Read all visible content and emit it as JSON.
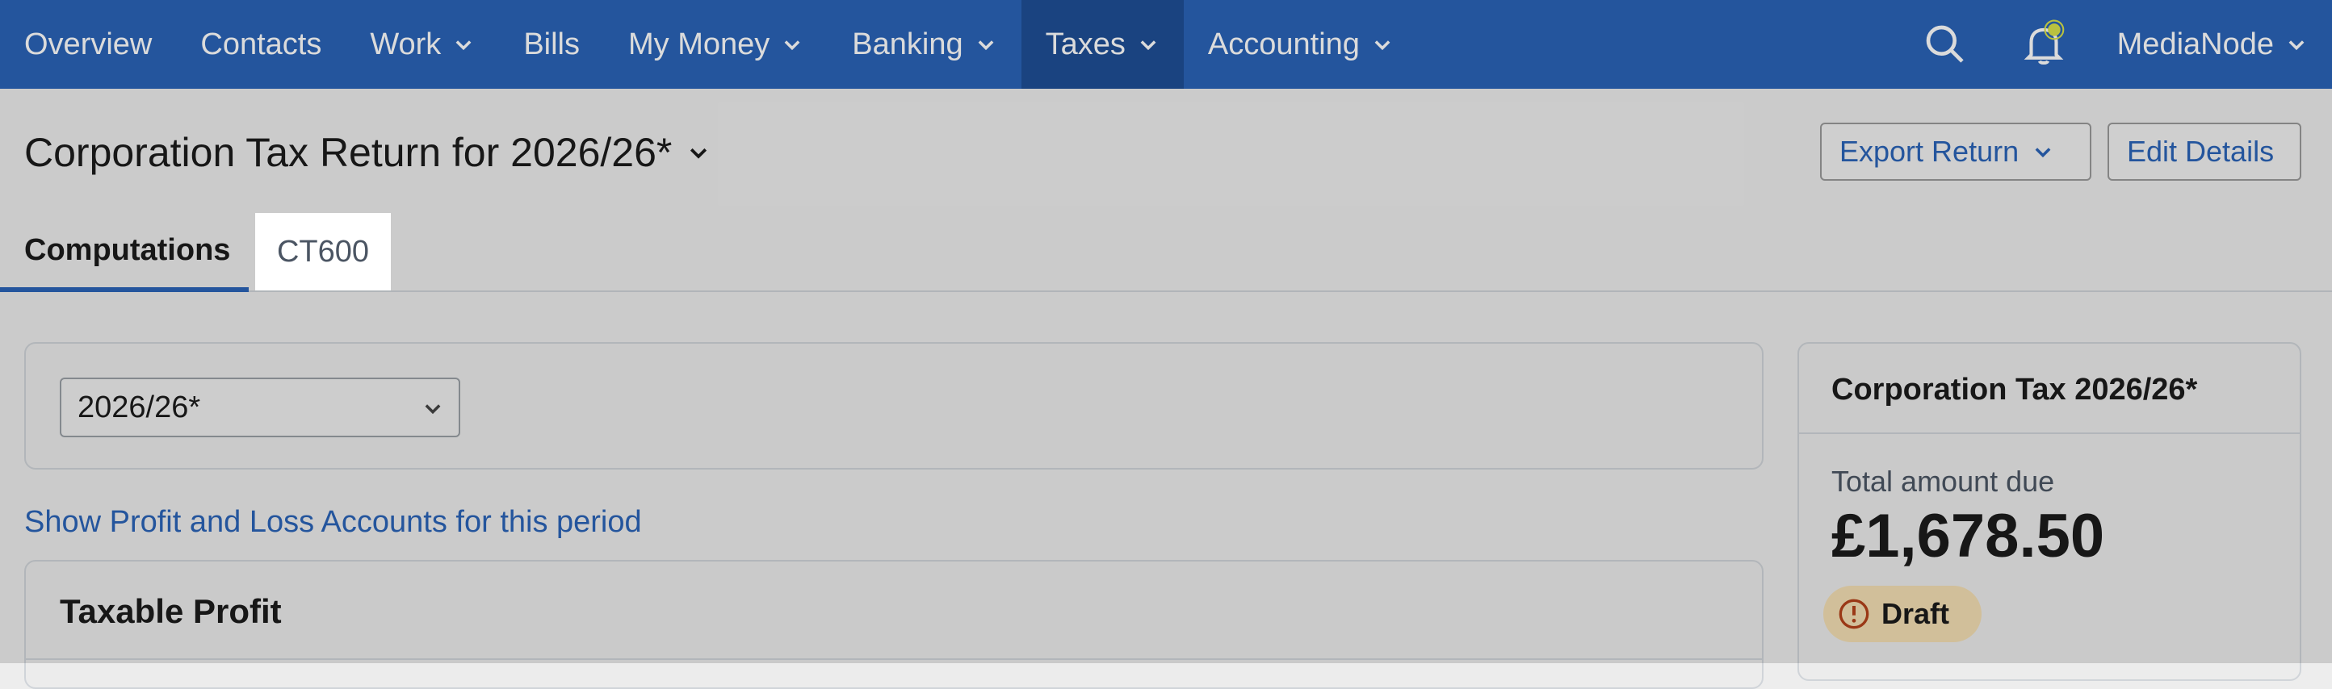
{
  "nav": {
    "items": [
      {
        "label": "Overview",
        "has_menu": false
      },
      {
        "label": "Contacts",
        "has_menu": false
      },
      {
        "label": "Work",
        "has_menu": true
      },
      {
        "label": "Bills",
        "has_menu": false
      },
      {
        "label": "My Money",
        "has_menu": true
      },
      {
        "label": "Banking",
        "has_menu": true
      },
      {
        "label": "Taxes",
        "has_menu": true,
        "active": true
      },
      {
        "label": "Accounting",
        "has_menu": true
      }
    ],
    "user": "MediaNode",
    "icons": {
      "search": "search-icon",
      "notifications": "bell-icon"
    },
    "colors": {
      "bar": "#2b64b7",
      "active": "#1f4f96",
      "notify_dot": "#d9e24a"
    }
  },
  "header": {
    "title": "Corporation Tax Return for 2026/26*",
    "export_button": "Export Return",
    "edit_button": "Edit Details"
  },
  "tabs": [
    {
      "label": "Computations",
      "active": true
    },
    {
      "label": "CT600",
      "active": false
    }
  ],
  "period_select": {
    "value": "2026/26*"
  },
  "link": "Show Profit and Loss Accounts for this period",
  "taxable_profit": {
    "heading": "Taxable Profit"
  },
  "summary": {
    "title": "Corporation Tax 2026/26*",
    "total_label": "Total amount due",
    "total_amount": "£1,678.50",
    "status": "Draft",
    "status_color": "#f4dfb4"
  }
}
